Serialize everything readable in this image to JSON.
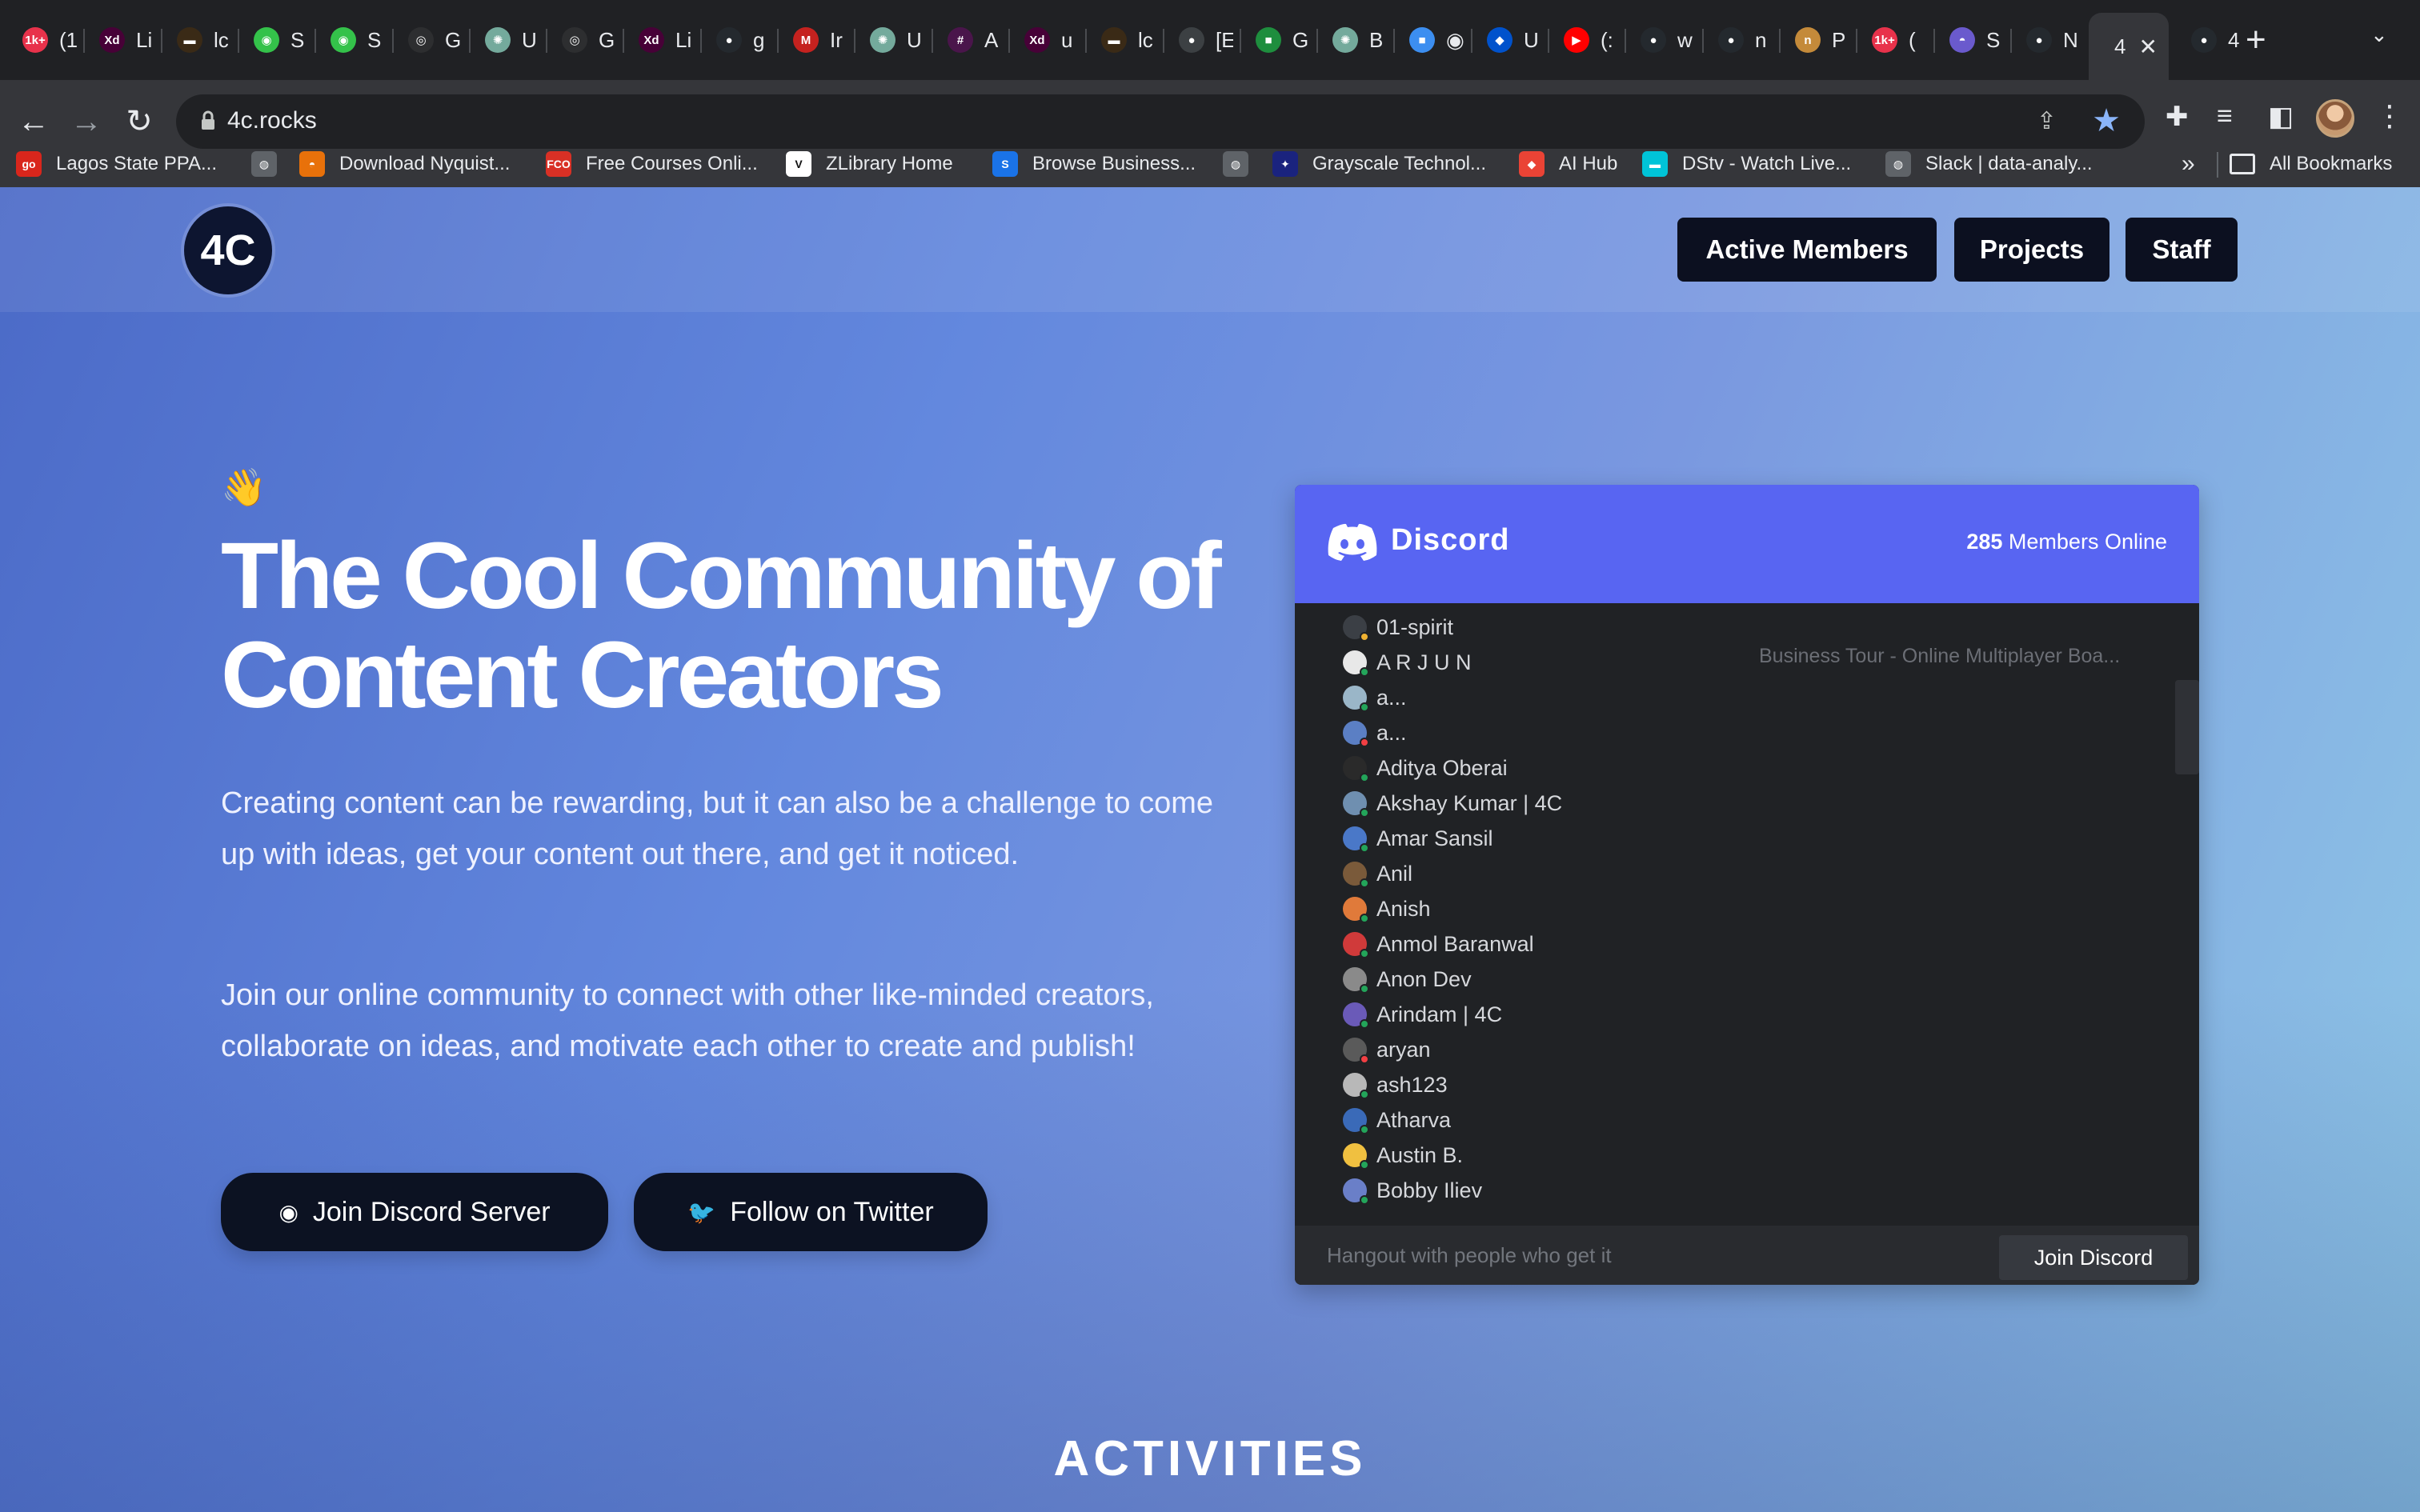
{
  "browser": {
    "tabs": [
      {
        "icon": "1k+",
        "color": "#e8324b",
        "label": "(1"
      },
      {
        "icon": "Xd",
        "color": "#470137",
        "label": "Li"
      },
      {
        "icon": "▬",
        "color": "#3a2a16",
        "label": "lc"
      },
      {
        "icon": "◉",
        "color": "#34c24a",
        "label": "S"
      },
      {
        "icon": "◉",
        "color": "#34c24a",
        "label": "S"
      },
      {
        "icon": "◎",
        "color": "#2d2e30",
        "label": "G"
      },
      {
        "icon": "✺",
        "color": "#74aa9c",
        "label": "U"
      },
      {
        "icon": "◎",
        "color": "#2d2e30",
        "label": "G"
      },
      {
        "icon": "Xd",
        "color": "#470137",
        "label": "Li"
      },
      {
        "icon": "●",
        "color": "#24292e",
        "label": "g"
      },
      {
        "icon": "M",
        "color": "#c5221f",
        "label": "Ir"
      },
      {
        "icon": "✺",
        "color": "#74aa9c",
        "label": "U"
      },
      {
        "icon": "#",
        "color": "#4a154b",
        "label": "A"
      },
      {
        "icon": "Xd",
        "color": "#470137",
        "label": "u"
      },
      {
        "icon": "▬",
        "color": "#3a2a16",
        "label": "lc"
      },
      {
        "icon": "●",
        "color": "#3c4043",
        "label": "[E"
      },
      {
        "icon": "■",
        "color": "#1e8e3e",
        "label": "G"
      },
      {
        "icon": "✺",
        "color": "#74aa9c",
        "label": "B"
      },
      {
        "icon": "■",
        "color": "#3c8ef0",
        "label": "◉"
      },
      {
        "icon": "◆",
        "color": "#0052cc",
        "label": "U"
      },
      {
        "icon": "▶",
        "color": "#ff0000",
        "label": "(:"
      },
      {
        "icon": "●",
        "color": "#24292e",
        "label": "w"
      },
      {
        "icon": "●",
        "color": "#24292e",
        "label": "n"
      },
      {
        "icon": "n",
        "color": "#c48a3a",
        "label": "P"
      },
      {
        "icon": "1k+",
        "color": "#e8324b",
        "label": "("
      },
      {
        "icon": "◓",
        "color": "#6a5acd",
        "label": "S"
      },
      {
        "icon": "●",
        "color": "#24292e",
        "label": "N"
      }
    ],
    "active_tab": {
      "label": "4",
      "close": "✕"
    },
    "last_tab": {
      "icon": "●",
      "color": "#24292e",
      "label": "4"
    },
    "new_tab": "+",
    "tab_search": "⌄",
    "url": "4c.rocks",
    "bookmarks": [
      {
        "icon": "go",
        "color": "#d9261c",
        "label": "Lagos State PPA..."
      },
      {
        "icon": "◍",
        "color": "#5f6368",
        "label": ""
      },
      {
        "icon": "◓",
        "color": "#e8710a",
        "label": "Download Nyquist..."
      },
      {
        "icon": "FCO",
        "color": "#d93025",
        "label": "Free Courses Onli..."
      },
      {
        "icon": "V",
        "color": "#ffffff",
        "label": "ZLibrary Home"
      },
      {
        "icon": "S",
        "color": "#1a73e8",
        "label": "Browse Business..."
      },
      {
        "icon": "◍",
        "color": "#5f6368",
        "label": ""
      },
      {
        "icon": "✦",
        "color": "#1a237e",
        "label": "Grayscale Technol..."
      },
      {
        "icon": "◆",
        "color": "#ea4335",
        "label": "AI Hub"
      },
      {
        "icon": "▬",
        "color": "#00c4d8",
        "label": "DStv - Watch Live..."
      },
      {
        "icon": "◍",
        "color": "#5f6368",
        "label": "Slack | data-analy..."
      }
    ],
    "bookmarks_more": "»",
    "all_bookmarks": "All Bookmarks"
  },
  "site": {
    "logo": "4C",
    "nav": [
      "Active Members",
      "Projects",
      "Staff"
    ],
    "wave": "👋",
    "title": "The Cool Community of Content Creators",
    "paragraph_1": "Creating content can be rewarding, but it can also be a challenge to come up with ideas, get your content out there, and get it noticed.",
    "paragraph_2": "Join our online community to connect with other like-minded creators, collaborate on ideas, and motivate each other to create and publish!",
    "cta_discord": "Join Discord Server",
    "cta_twitter": "Follow on Twitter",
    "section_title": "ACTIVITIES"
  },
  "discord": {
    "wordmark": "Discord",
    "online_count": "285",
    "online_label": "Members Online",
    "members": [
      {
        "name": "01-spirit",
        "avatar": "#3b3f45",
        "status": "#f0b232"
      },
      {
        "name": "A R J U N",
        "avatar": "#e8e8e8",
        "status": "#23a55a"
      },
      {
        "name": "a...",
        "avatar": "#9ab6c8",
        "status": "#23a55a"
      },
      {
        "name": "a...",
        "avatar": "#5b7fc4",
        "status": "#f23f43"
      },
      {
        "name": "Aditya Oberai",
        "avatar": "#2a2a2a",
        "status": "#23a55a"
      },
      {
        "name": "Akshay Kumar | 4C",
        "avatar": "#6f8fb0",
        "status": "#23a55a"
      },
      {
        "name": "Amar Sansil",
        "avatar": "#4a78c8",
        "status": "#23a55a"
      },
      {
        "name": "Anil",
        "avatar": "#7a5a3a",
        "status": "#23a55a"
      },
      {
        "name": "Anish",
        "avatar": "#e07a3a",
        "status": "#23a55a"
      },
      {
        "name": "Anmol Baranwal",
        "avatar": "#d03a3a",
        "status": "#23a55a"
      },
      {
        "name": "Anon Dev",
        "avatar": "#8a8a8a",
        "status": "#23a55a"
      },
      {
        "name": "Arindam | 4C",
        "avatar": "#6a5ab8",
        "status": "#23a55a"
      },
      {
        "name": "aryan",
        "avatar": "#5a5a5a",
        "status": "#f23f43"
      },
      {
        "name": "ash123",
        "avatar": "#b8b8b8",
        "status": "#23a55a"
      },
      {
        "name": "Atharva",
        "avatar": "#3a6ab8",
        "status": "#23a55a"
      },
      {
        "name": "Austin B.",
        "avatar": "#f0c040",
        "status": "#23a55a"
      },
      {
        "name": "Bobby Iliev",
        "avatar": "#6a7fc8",
        "status": "#23a55a"
      }
    ],
    "member_game": "Business Tour - Online Multiplayer Boa...",
    "tagline": "Hangout with people who get it",
    "join_label": "Join Discord"
  },
  "colors": {
    "discord_blurple": "#5865f2",
    "nav_pill": "#0c1020",
    "cta": "#0c1222"
  }
}
